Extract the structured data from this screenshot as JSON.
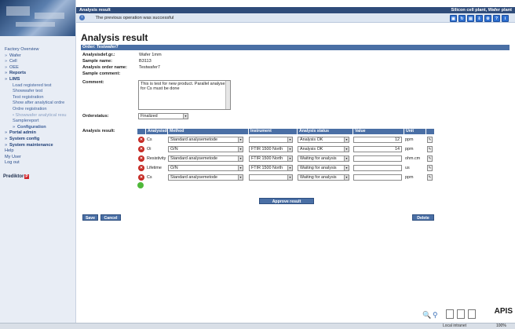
{
  "window": {
    "title": "Analysis result",
    "company": "Silicon cell plant, Wafer plant"
  },
  "message": "The previous operation was successful",
  "sidebar": {
    "items": [
      {
        "label": "Factory Overview",
        "level": 0,
        "arrow": false
      },
      {
        "label": "Wafer",
        "level": 0,
        "arrow": true
      },
      {
        "label": "Cell",
        "level": 0,
        "arrow": true
      },
      {
        "label": "OEE",
        "level": 0,
        "arrow": true
      },
      {
        "label": "Reports",
        "level": 0,
        "arrow": true,
        "bold": true
      },
      {
        "label": "LIMS",
        "level": 0,
        "arrow": true,
        "bold": true
      },
      {
        "label": "Load registered test",
        "level": 1
      },
      {
        "label": "Showwafer test",
        "level": 1
      },
      {
        "label": "Test registration",
        "level": 1
      },
      {
        "label": "Show after analytical ordre",
        "level": 1
      },
      {
        "label": "Ordre registration",
        "level": 1
      },
      {
        "label": "• Showwafer analytical resu",
        "level": 1,
        "dim": true
      },
      {
        "label": "Samplereport",
        "level": 1
      },
      {
        "label": "Configuration",
        "level": 1,
        "arrow": true,
        "bold": true
      },
      {
        "label": "Portal admin",
        "level": 0,
        "arrow": true,
        "bold": true
      },
      {
        "label": "System config",
        "level": 0,
        "arrow": true,
        "bold": true
      },
      {
        "label": "System maintenance",
        "level": 0,
        "arrow": true,
        "bold": true
      },
      {
        "label": "Help",
        "level": 0
      },
      {
        "label": "My User",
        "level": 0
      },
      {
        "label": "Log out",
        "level": 0
      }
    ],
    "brand": "Prediktor",
    "brand_badge": "P"
  },
  "page": {
    "title": "Analysis result",
    "order_bar": "Order: Testwafer7"
  },
  "order": {
    "fields": [
      {
        "label": "Analysisdef.gr.:",
        "value": "Wafer 1mm"
      },
      {
        "label": "Sample name:",
        "value": "B3113"
      },
      {
        "label": "Analysis order name:",
        "value": "Testwafer7"
      },
      {
        "label": "Sample comment:",
        "value": ""
      },
      {
        "label": "Comment:",
        "value": ""
      }
    ],
    "comment": "This is test for new product. Parallel analyses for Cs must be done",
    "orderstatus_label": "Orderstatus:",
    "orderstatus_value": "Finalized",
    "analysis_result_label": "Analysis result:"
  },
  "table": {
    "headers": [
      "",
      "Analysisdef",
      "Method",
      "Instrument",
      "Analysis status",
      "Value",
      "Unit",
      ""
    ],
    "rows": [
      {
        "name": "Cs",
        "method": "Standard analysemetode",
        "instrument": "",
        "status": "Analysis OK",
        "value": "12",
        "unit": "ppm"
      },
      {
        "name": "Oi",
        "method": "O/N",
        "instrument": "FTIR 1500 North",
        "status": "Analysis OK",
        "value": "14",
        "unit": "ppm"
      },
      {
        "name": "Resistivity",
        "method": "Standard analysemetode",
        "instrument": "FTIR 1500 North",
        "status": "Waiting for analysis",
        "value": "",
        "unit": "ohm.cm"
      },
      {
        "name": "Lifetime",
        "method": "O/N",
        "instrument": "FTIR 1500 North",
        "status": "Waiting for analysis",
        "value": "",
        "unit": "us"
      },
      {
        "name": "Cs",
        "method": "Standard analysemetode",
        "instrument": "",
        "status": "Waiting for analysis",
        "value": "",
        "unit": "ppm"
      }
    ]
  },
  "buttons": {
    "approve": "Approve result",
    "save": "Save",
    "cancel": "Cancel",
    "delete": "Delete"
  },
  "footer": {
    "brand": "APIS",
    "zoom": "100%",
    "status": "Local intranet"
  },
  "colors": {
    "header_blue": "#4a6fa5",
    "delete_red": "#c52a24",
    "add_green": "#4fb83a"
  }
}
